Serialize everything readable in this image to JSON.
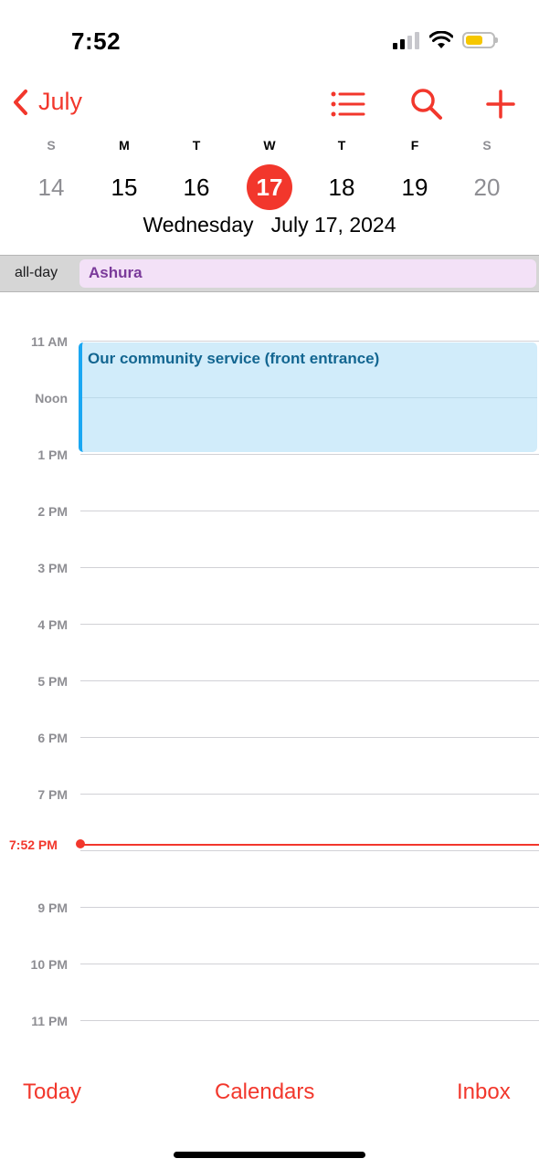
{
  "status_bar": {
    "time": "7:52",
    "battery_color": "#f6c700"
  },
  "header": {
    "back_label": "July",
    "icons": [
      "back-chevron-icon",
      "list-icon",
      "search-icon",
      "add-icon"
    ],
    "accent_color": "#f2372c"
  },
  "week": {
    "days": [
      {
        "dow": "S",
        "num": "14",
        "weekend": true
      },
      {
        "dow": "M",
        "num": "15",
        "weekend": false
      },
      {
        "dow": "T",
        "num": "16",
        "weekend": false
      },
      {
        "dow": "W",
        "num": "17",
        "weekend": false,
        "selected": true
      },
      {
        "dow": "T",
        "num": "18",
        "weekend": false
      },
      {
        "dow": "F",
        "num": "19",
        "weekend": false
      },
      {
        "dow": "S",
        "num": "20",
        "weekend": true
      }
    ],
    "selected_date_title": "Wednesday   July 17, 2024"
  },
  "all_day": {
    "label": "all-day",
    "event": "Ashura",
    "event_color": "#f3e1f7"
  },
  "timeline": {
    "hours": [
      "11 AM",
      "Noon",
      "1 PM",
      "2 PM",
      "3 PM",
      "4 PM",
      "5 PM",
      "6 PM",
      "7 PM",
      "9 PM",
      "10 PM",
      "11 PM"
    ],
    "current_time": "7:52 PM",
    "now_color": "#f2372c"
  },
  "event": {
    "title": "Our community service (front entrance)",
    "color": "#d1ecfa"
  },
  "tab_bar": {
    "today": "Today",
    "calendars": "Calendars",
    "inbox": "Inbox"
  }
}
